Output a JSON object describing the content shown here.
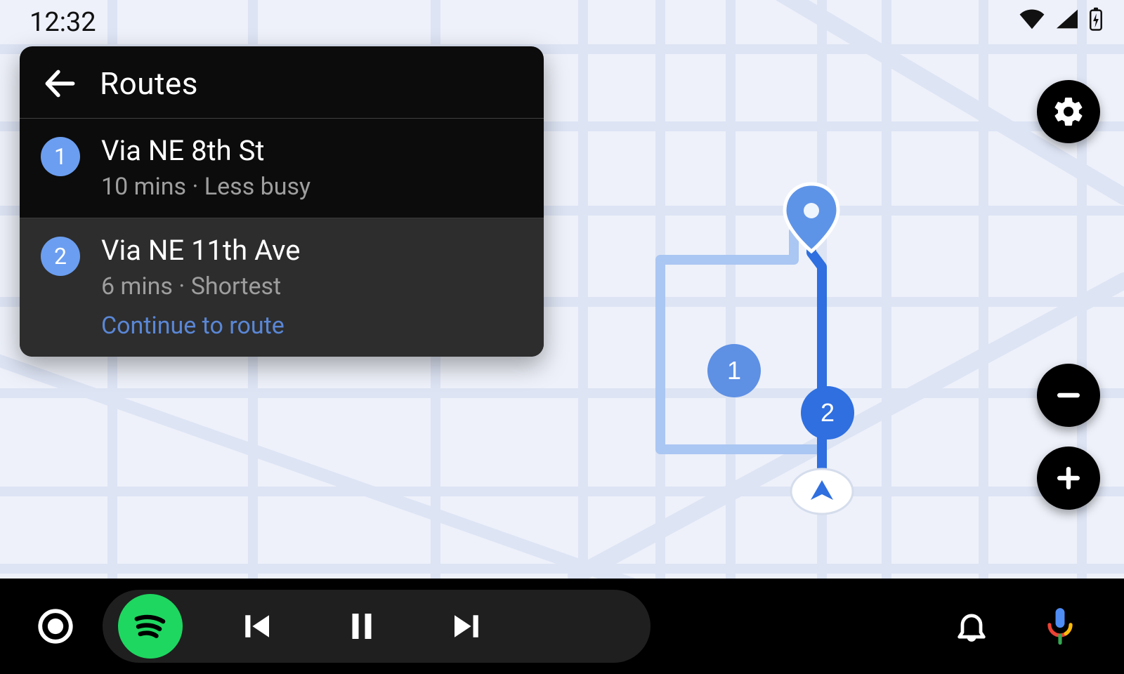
{
  "status": {
    "time": "12:32"
  },
  "panel": {
    "title": "Routes",
    "continue_label": "Continue to route",
    "routes": [
      {
        "badge": "1",
        "title": "Via NE 8th St",
        "sub": "10 mins · Less busy",
        "selected": false
      },
      {
        "badge": "2",
        "title": "Via NE 11th Ave",
        "sub": "6 mins · Shortest",
        "selected": true
      }
    ]
  },
  "map": {
    "markers": [
      {
        "badge": "1"
      },
      {
        "badge": "2"
      }
    ]
  },
  "colors": {
    "accent_soft": "#6b9ef0",
    "accent_deep": "#2f6fe0",
    "route_line": "#dfe5f5",
    "spotify": "#1ed760",
    "continue": "#5a87d6"
  }
}
